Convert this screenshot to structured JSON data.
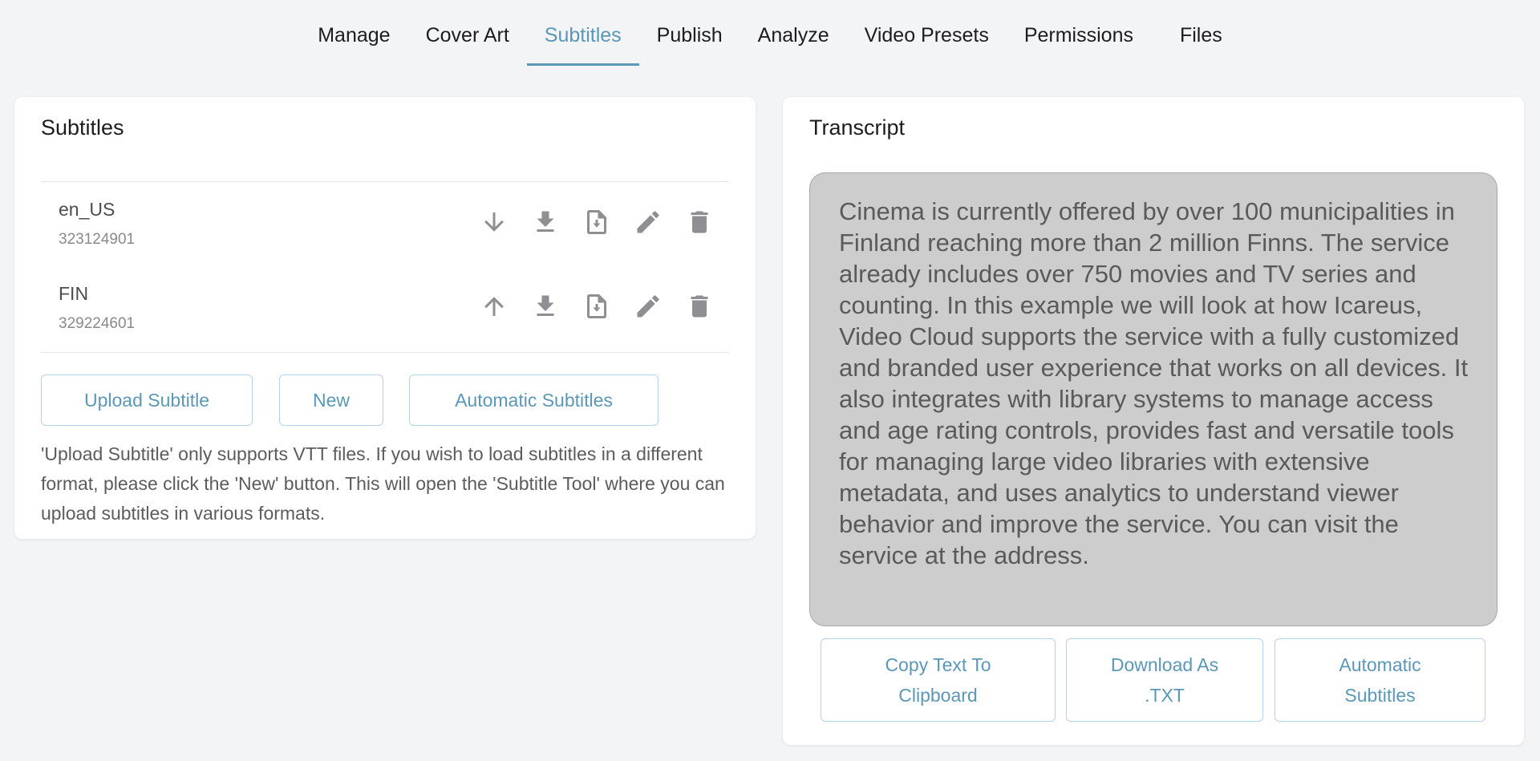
{
  "tabs": [
    {
      "label": "Manage"
    },
    {
      "label": "Cover Art"
    },
    {
      "label": "Subtitles",
      "active": true
    },
    {
      "label": "Publish"
    },
    {
      "label": "Analyze"
    },
    {
      "label": "Video Presets"
    },
    {
      "label": "Permissions"
    },
    {
      "label": "Files"
    }
  ],
  "subtitles_panel": {
    "title": "Subtitles",
    "rows": [
      {
        "lang": "en_US",
        "id": "323124901",
        "move_icon": "arrow-down-icon"
      },
      {
        "lang": "FIN",
        "id": "329224601",
        "move_icon": "arrow-up-icon"
      }
    ],
    "buttons": {
      "upload": "Upload Subtitle",
      "new": "New",
      "automatic": "Automatic Subtitles"
    },
    "help": "'Upload Subtitle' only supports VTT files. If you wish to load subtitles in a different format, please click the 'New' button. This will open the 'Subtitle Tool' where you can upload subtitles in various formats."
  },
  "transcript_panel": {
    "title": "Transcript",
    "text": "Cinema is currently offered by over 100 municipalities in Finland reaching more than 2 million Finns. The service already includes over 750 movies and TV series and counting. In this example we will look at how Icareus, Video Cloud supports the service with a fully customized and branded user experience that works on all devices. It also integrates with library systems to manage access and age rating controls, provides fast and versatile tools for managing large video libraries with extensive metadata, and uses analytics to understand viewer behavior and improve the service. You can visit the service at the address.",
    "buttons": {
      "copy": [
        "Copy Text To",
        "Clipboard"
      ],
      "download": [
        "Download As",
        ".TXT"
      ],
      "automatic": [
        "Automatic",
        "Subtitles"
      ]
    }
  },
  "colors": {
    "accent": "#5b97b7",
    "icon": "#8e8e93",
    "transcript_bg": "#cdcdcd"
  }
}
